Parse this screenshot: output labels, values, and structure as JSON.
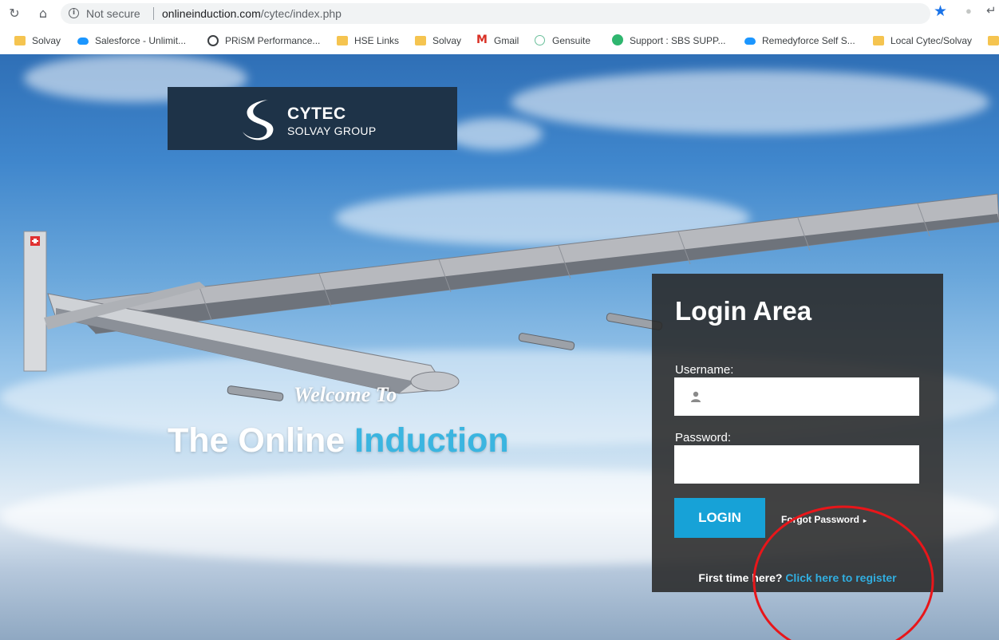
{
  "browser": {
    "url_security": "Not secure",
    "url_host": "onlineinduction.com",
    "url_path": "/cytec/index.php",
    "bookmarks": [
      {
        "label": "Solvay",
        "icon": "folder-icon"
      },
      {
        "label": "Salesforce - Unlimit...",
        "icon": "salesforce-cloud-icon"
      },
      {
        "label": "PRiSM Performance...",
        "icon": "globe-icon"
      },
      {
        "label": "HSE Links",
        "icon": "folder-icon"
      },
      {
        "label": "Solvay",
        "icon": "folder-icon"
      },
      {
        "label": "Gmail",
        "icon": "gmail-icon"
      },
      {
        "label": "Gensuite",
        "icon": "gensuite-icon"
      },
      {
        "label": "Support : SBS SUPP...",
        "icon": "support-icon"
      },
      {
        "label": "Remedyforce Self S...",
        "icon": "salesforce-cloud-icon"
      },
      {
        "label": "Local Cytec/Solvay",
        "icon": "folder-icon"
      }
    ]
  },
  "logo": {
    "title": "CYTEC",
    "subtitle": "SOLVAY GROUP"
  },
  "hero": {
    "welcome": "Welcome To",
    "headline_part1": "The Online ",
    "headline_part2": "Induction"
  },
  "login": {
    "title": "Login Area",
    "username_label": "Username:",
    "password_label": "Password:",
    "username_value": "",
    "password_value": "",
    "login_button": "LOGIN",
    "forgot_password": "Forgot Password",
    "first_time_text": "First time here? ",
    "register_link": "Click here to register"
  },
  "colors": {
    "accent": "#17a2d7",
    "annotation": "#e8161a",
    "logo_bg": "#1e3348"
  }
}
